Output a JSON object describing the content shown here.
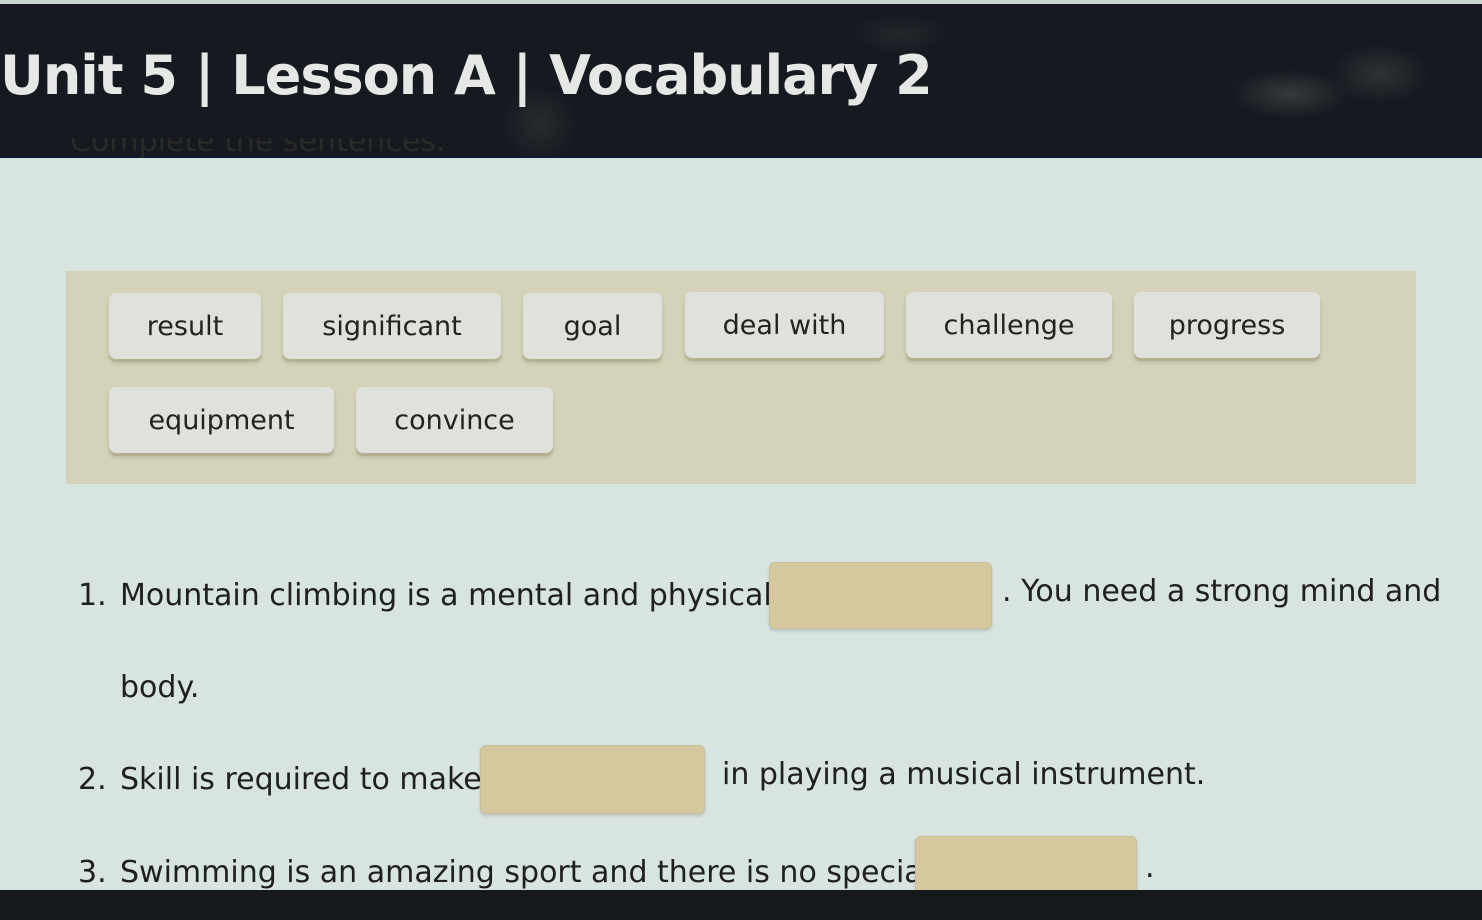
{
  "header": {
    "title": "Unit 5 | Lesson A | Vocabulary 2"
  },
  "instruction": "Complete the sentences.",
  "word_bank": [
    {
      "label": "result"
    },
    {
      "label": "significant"
    },
    {
      "label": "goal"
    },
    {
      "label": "deal with"
    },
    {
      "label": "challenge"
    },
    {
      "label": "progress"
    },
    {
      "label": "equipment"
    },
    {
      "label": "convince"
    }
  ],
  "questions": [
    {
      "number": "1.",
      "before": "Mountain climbing is a mental and physical",
      "after": ". You need a strong mind and",
      "continuation": "body.",
      "answer": ""
    },
    {
      "number": "2.",
      "before": "Skill is required to make",
      "after": "in playing a musical instrument.",
      "answer": ""
    },
    {
      "number": "3.",
      "before": "Swimming is an amazing sport and there is no special",
      "after": ".",
      "answer": ""
    }
  ],
  "colors": {
    "header_bg": "#16191f",
    "page_bg": "#d8e4df",
    "word_bank_bg": "#d4d3b9",
    "chip_bg": "#dfe1da",
    "blank_bg": "#d5c89f"
  }
}
